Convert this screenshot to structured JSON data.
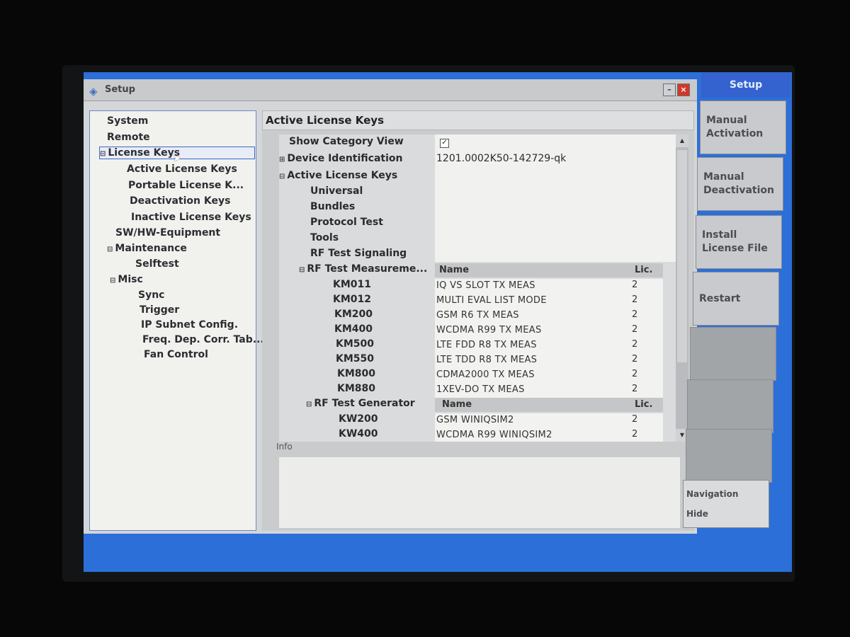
{
  "dialog": {
    "title": "Setup",
    "icon": "rohde-schwarz-logo-icon"
  },
  "tree": [
    {
      "label": "System"
    },
    {
      "label": "Remote"
    },
    {
      "label": "License Keys",
      "expander": "⊟",
      "selected": true
    },
    {
      "label": "Active License Keys"
    },
    {
      "label": "Portable License K..."
    },
    {
      "label": "Deactivation Keys"
    },
    {
      "label": "Inactive License Keys"
    },
    {
      "label": "SW/HW-Equipment"
    },
    {
      "label": "Maintenance",
      "expander": "⊟"
    },
    {
      "label": "Selftest"
    },
    {
      "label": "Misc",
      "expander": "⊟"
    },
    {
      "label": "Sync"
    },
    {
      "label": "Trigger"
    },
    {
      "label": "IP Subnet Config."
    },
    {
      "label": "Freq. Dep. Corr. Tab..."
    },
    {
      "label": "Fan Control"
    }
  ],
  "content": {
    "header": "Active License Keys",
    "show_category_view": {
      "label": "Show Category View",
      "checked": true,
      "mark": "✓"
    },
    "device_identification": {
      "label": "Device Identification",
      "expander": "⊞",
      "value": "1201.0002K50-142729-qk"
    },
    "active_license_keys": {
      "label": "Active License Keys",
      "expander": "⊟"
    },
    "categories": [
      "Universal",
      "Bundles",
      "Protocol Test",
      "Tools",
      "RF Test Signaling"
    ],
    "measurements": {
      "label": "RF Test Measureme...",
      "expander": "⊟",
      "col_name": "Name",
      "col_lic": "Lic.",
      "rows": [
        {
          "key": "KM011",
          "name": "IQ VS SLOT TX MEAS",
          "lic": "2"
        },
        {
          "key": "KM012",
          "name": "MULTI EVAL LIST MODE",
          "lic": "2"
        },
        {
          "key": "KM200",
          "name": "GSM R6 TX MEAS",
          "lic": "2"
        },
        {
          "key": "KM400",
          "name": "WCDMA R99 TX MEAS",
          "lic": "2"
        },
        {
          "key": "KM500",
          "name": "LTE FDD R8 TX MEAS",
          "lic": "2"
        },
        {
          "key": "KM550",
          "name": "LTE TDD R8 TX MEAS",
          "lic": "2"
        },
        {
          "key": "KM800",
          "name": "CDMA2000 TX MEAS",
          "lic": "2"
        },
        {
          "key": "KM880",
          "name": "1XEV-DO TX MEAS",
          "lic": "2"
        }
      ]
    },
    "generator": {
      "label": "RF Test Generator",
      "expander": "⊟",
      "col_name": "Name",
      "col_lic": "Lic.",
      "rows": [
        {
          "key": "KW200",
          "name": "GSM WINIQSIM2",
          "lic": "2"
        },
        {
          "key": "KW400",
          "name": "WCDMA R99 WINIQSIM2",
          "lic": "2"
        }
      ]
    },
    "info_label": "Info"
  },
  "softkeys": {
    "header": "Setup",
    "buttons": [
      {
        "line1": "Manual",
        "line2": "Activation"
      },
      {
        "line1": "Manual",
        "line2": "Deactivation"
      },
      {
        "line1": "Install",
        "line2": "License File"
      },
      {
        "line1": "Restart",
        "line2": ""
      },
      {
        "line1": "",
        "line2": ""
      },
      {
        "line1": "",
        "line2": ""
      },
      {
        "line1": "",
        "line2": ""
      }
    ],
    "navigation": {
      "line1": "Navigation",
      "line2": "Hide"
    }
  }
}
